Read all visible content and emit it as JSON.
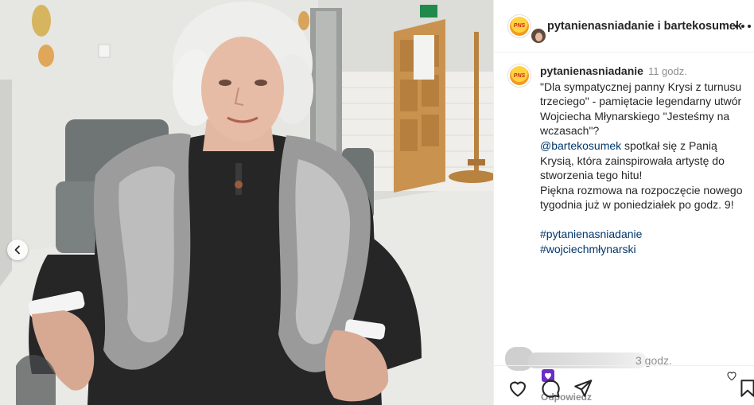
{
  "post": {
    "photo_alt": "",
    "accent_link_color": "#00376b"
  },
  "header": {
    "account_1": "pytanienasniadanie",
    "joiner": " i ",
    "account_2": "bartekosumek",
    "avatar_logo_text": "PNS",
    "more_icon": "more-horizontal-icon"
  },
  "caption": {
    "username": "pytanienasniadanie",
    "time": "11 godz.",
    "lines_before_mention": "\"Dla sympatycznej panny Krysi z turnusu trzeciego\" - pamiętacie legendarny utwór Wojciecha Młynarskiego \"Jesteśmy na wczasach\"?",
    "mention": "@bartekosumek",
    "lines_after_mention": " spotkał się z Panią Krysią, która zainspirowała artystę do stworzenia tego hitu!",
    "paragraph_2": "Piękna rozmowa na rozpoczęcie nowego tygodnia już w poniedziałek po godz. 9!",
    "hashtag_1": "#pytanienasniadanie",
    "hashtag_2": "#wojciechmłynarski"
  },
  "comment": {
    "time": "3 godz.",
    "reaction_icon": "purple-heart-emoji",
    "reply_label": "Odpowiedz",
    "like_icon": "heart-outline-icon"
  },
  "actions": {
    "like_icon": "heart-outline-icon",
    "comment_icon": "comment-bubble-icon",
    "share_icon": "paper-plane-icon",
    "save_icon": "bookmark-icon"
  },
  "carousel": {
    "prev_icon": "chevron-left-icon"
  }
}
